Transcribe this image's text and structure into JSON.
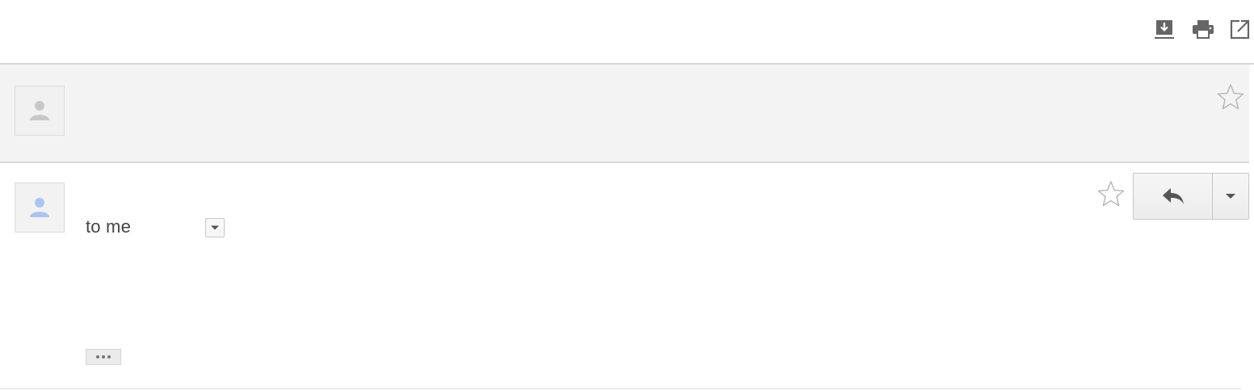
{
  "thread": {
    "subject": "",
    "toolbar": {
      "download_icon": "download-icon",
      "print_icon": "print-icon",
      "popout_icon": "open-in-new-window-icon"
    }
  },
  "collapsed_message": {
    "sender": "",
    "snippet": "",
    "avatar_icon": "person-icon",
    "starred": false
  },
  "expanded_message": {
    "sender": "",
    "recipient_line": "to me",
    "body": "",
    "avatar_icon": "person-icon",
    "starred": false,
    "reply_icon": "reply-icon",
    "more_icon": "chevron-down-icon",
    "trimmed_content_icon": "ellipsis-icon"
  },
  "colors": {
    "avatar_collapsed": "#c8c8c8",
    "avatar_expanded": "#a8c5f0",
    "divider": "#d8d8d8",
    "collapsed_bg": "#f3f3f3"
  }
}
